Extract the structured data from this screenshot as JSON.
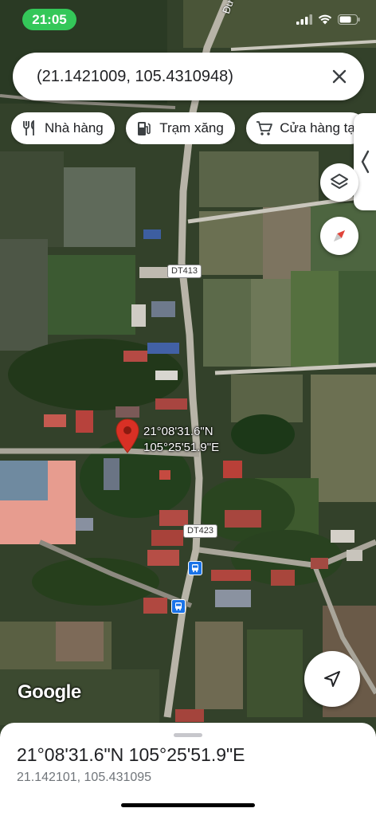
{
  "status_bar": {
    "time": "21:05"
  },
  "map": {
    "street_label": "Đường",
    "road_labels": [
      "DT413",
      "DT423"
    ],
    "pin_label": {
      "line1": "21°08'31.6\"N",
      "line2": "105°25'51.9\"E"
    },
    "logo": "Google"
  },
  "search": {
    "value": "(21.1421009, 105.4310948)"
  },
  "chips": [
    {
      "label": "Nhà hàng",
      "icon": "restaurant-icon"
    },
    {
      "label": "Trạm xăng",
      "icon": "gas-station-icon"
    },
    {
      "label": "Cửa hàng tạ",
      "icon": "shopping-cart-icon"
    }
  ],
  "sheet": {
    "title": "21°08'31.6\"N 105°25'51.9\"E",
    "coords": "21.142101, 105.431095"
  },
  "colors": {
    "pin": "#d93025",
    "status_pill": "#34c759",
    "bus": "#1a73e8"
  }
}
